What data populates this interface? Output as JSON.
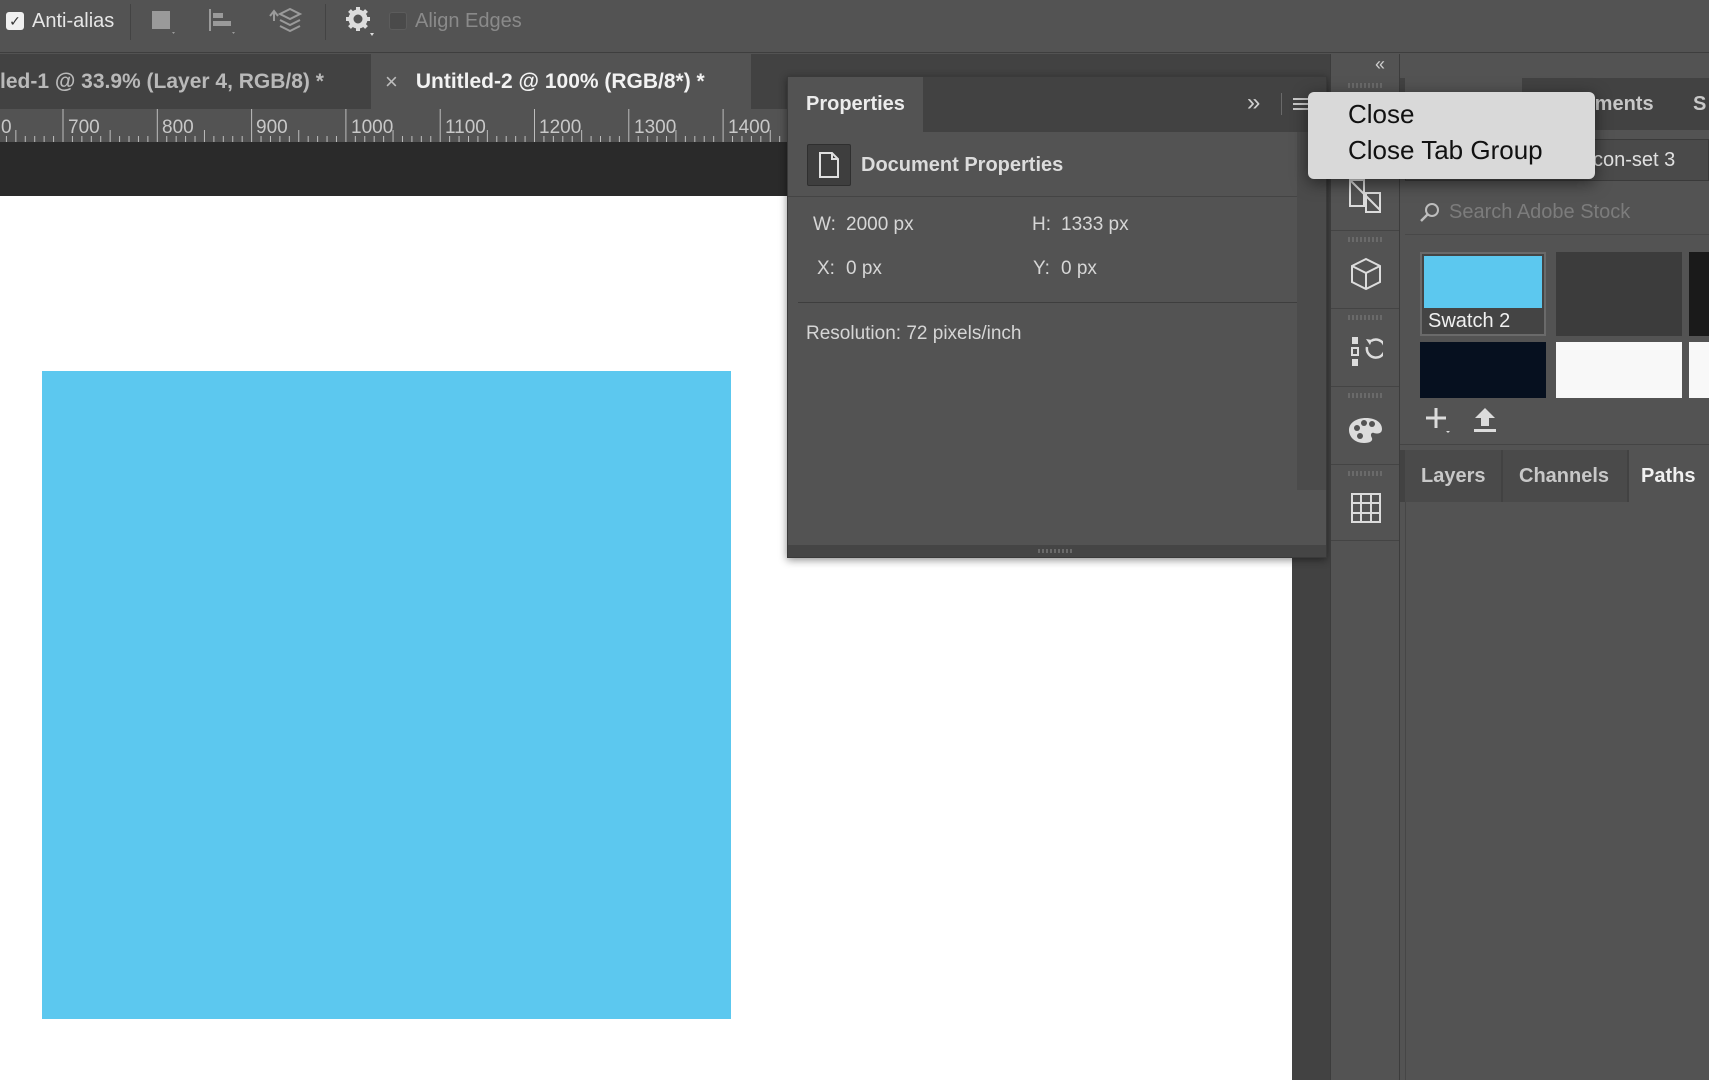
{
  "options_bar": {
    "anti_alias_label": "Anti-alias",
    "anti_alias_checked": true,
    "align_edges_label": "Align Edges",
    "align_edges_checked": false
  },
  "documents": {
    "tabs": [
      {
        "title": "led-1 @ 33.9% (Layer 4, RGB/8) *",
        "active": false
      },
      {
        "title": "Untitled-2 @ 100% (RGB/8*) *",
        "active": true,
        "close_glyph": "×"
      }
    ]
  },
  "ruler": {
    "labels": [
      "0",
      "700",
      "800",
      "900",
      "1000",
      "1100",
      "1200",
      "1300",
      "1400"
    ]
  },
  "canvas": {
    "shape_color": "#5cc8ef",
    "background_color": "#ffffff"
  },
  "properties": {
    "tab_label": "Properties",
    "collapse_glyph": "»",
    "section_title": "Document Properties",
    "w_label": "W:",
    "w_value": "2000 px",
    "h_label": "H:",
    "h_value": "1333 px",
    "x_label": "X:",
    "x_value": "0 px",
    "y_label": "Y:",
    "y_value": "0 px",
    "resolution": "Resolution: 72 pixels/inch"
  },
  "icon_strip": {
    "collapse_glyph": "‹‹",
    "icons": [
      "libraries-icon",
      "3d-cube-icon",
      "history-icon",
      "swatches-palette-icon",
      "grid-icon"
    ]
  },
  "context_menu": {
    "items": [
      "Close",
      "Close Tab Group"
    ]
  },
  "right_dock": {
    "top_tabs_partial": [
      "tments",
      "S"
    ],
    "library_name_partial": "con-set 3",
    "search_placeholder": "Search Adobe Stock",
    "swatch_label": "Swatch 2",
    "swatches": [
      {
        "color": "#5cc8ef",
        "selected": true
      },
      {
        "color": "#3c3c3c",
        "selected": false
      },
      {
        "color": "#1a1a1a",
        "selected": false
      },
      {
        "color": "#06101f",
        "selected": false
      },
      {
        "color": "#f8f8f8",
        "selected": false
      },
      {
        "color": "#f8f8f8",
        "selected": false
      }
    ],
    "bottom_tabs": [
      {
        "label": "Layers",
        "active": false
      },
      {
        "label": "Channels",
        "active": false
      },
      {
        "label": "Paths",
        "active": true
      }
    ]
  }
}
